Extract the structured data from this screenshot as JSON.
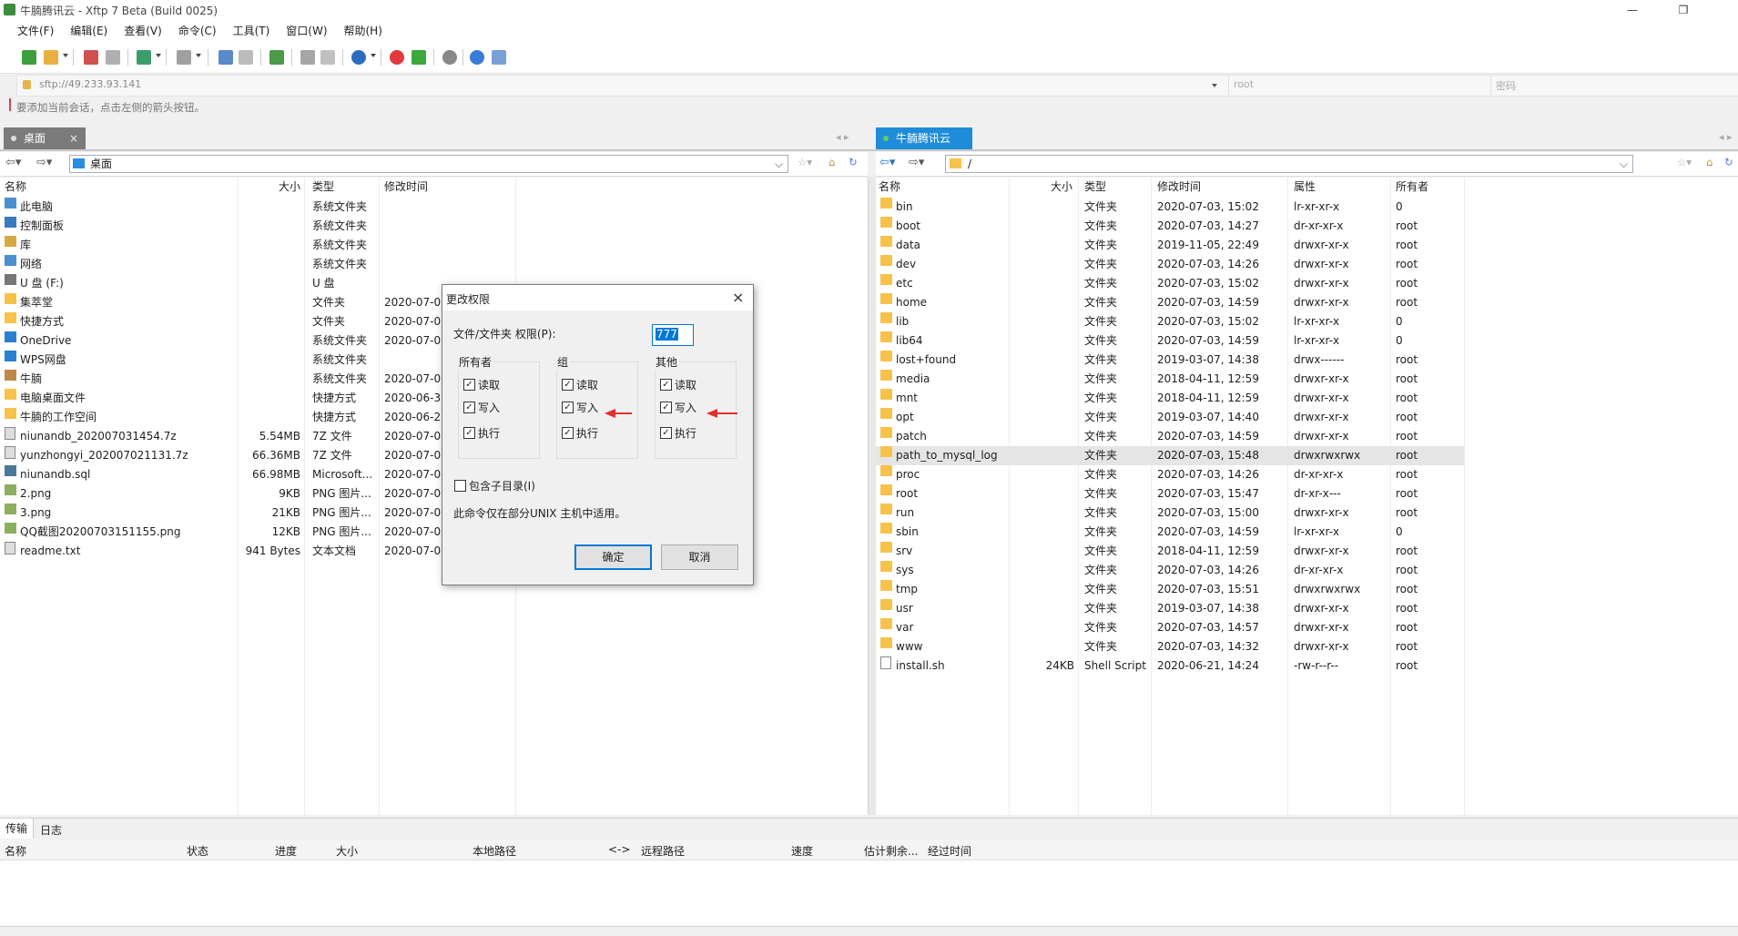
{
  "window": {
    "title": "牛腩腾讯云 - Xftp 7 Beta (Build 0025)"
  },
  "menu": [
    "文件(F)",
    "编辑(E)",
    "查看(V)",
    "命令(C)",
    "工具(T)",
    "窗口(W)",
    "帮助(H)"
  ],
  "address": {
    "url": "sftp://49.233.93.141",
    "user_placeholder": "root",
    "password_placeholder": "密码"
  },
  "hint": "要添加当前会话，点击左侧的箭头按钮。",
  "left": {
    "tab": "桌面",
    "path": "桌面",
    "columns": [
      "名称",
      "大小",
      "类型",
      "修改时间"
    ],
    "rows": [
      {
        "name": "此电脑",
        "size": "",
        "type": "系统文件夹",
        "date": "",
        "icon": "computer-icon"
      },
      {
        "name": "控制面板",
        "size": "",
        "type": "系统文件夹",
        "date": "",
        "icon": "control-panel-icon"
      },
      {
        "name": "库",
        "size": "",
        "type": "系统文件夹",
        "date": "",
        "icon": "library-icon"
      },
      {
        "name": "网络",
        "size": "",
        "type": "系统文件夹",
        "date": "",
        "icon": "network-icon"
      },
      {
        "name": "U 盘 (F:)",
        "size": "",
        "type": "U 盘",
        "date": "",
        "icon": "usb-drive-icon"
      },
      {
        "name": "集萃堂",
        "size": "",
        "type": "文件夹",
        "date": "2020-07-0",
        "icon": "folder-icon"
      },
      {
        "name": "快捷方式",
        "size": "",
        "type": "文件夹",
        "date": "2020-07-0",
        "icon": "folder-icon"
      },
      {
        "name": "OneDrive",
        "size": "",
        "type": "系统文件夹",
        "date": "2020-07-0",
        "icon": "cloud-icon"
      },
      {
        "name": "WPS网盘",
        "size": "",
        "type": "系统文件夹",
        "date": "",
        "icon": "cloud-icon"
      },
      {
        "name": "牛腩",
        "size": "",
        "type": "系统文件夹",
        "date": "2020-07-0",
        "icon": "user-icon"
      },
      {
        "name": "电脑桌面文件",
        "size": "",
        "type": "快捷方式",
        "date": "2020-06-3",
        "icon": "shortcut-icon"
      },
      {
        "name": "牛腩的工作空间",
        "size": "",
        "type": "快捷方式",
        "date": "2020-06-2",
        "icon": "shortcut-icon"
      },
      {
        "name": "niunandb_202007031454.7z",
        "size": "5.54MB",
        "type": "7Z 文件",
        "date": "2020-07-0",
        "icon": "file-icon"
      },
      {
        "name": "yunzhongyi_202007021131.7z",
        "size": "66.36MB",
        "type": "7Z 文件",
        "date": "2020-07-0",
        "icon": "file-icon"
      },
      {
        "name": "niunandb.sql",
        "size": "66.98MB",
        "type": "Microsoft...",
        "date": "2020-07-0",
        "icon": "sql-file-icon"
      },
      {
        "name": "2.png",
        "size": "9KB",
        "type": "PNG 图片...",
        "date": "2020-07-0",
        "icon": "image-icon"
      },
      {
        "name": "3.png",
        "size": "21KB",
        "type": "PNG 图片...",
        "date": "2020-07-0",
        "icon": "image-icon"
      },
      {
        "name": "QQ截图20200703151155.png",
        "size": "12KB",
        "type": "PNG 图片...",
        "date": "2020-07-0",
        "icon": "image-icon"
      },
      {
        "name": "readme.txt",
        "size": "941 Bytes",
        "type": "文本文档",
        "date": "2020-07-0",
        "icon": "text-file-icon"
      }
    ]
  },
  "right": {
    "tab": "牛腩腾讯云",
    "path": "/",
    "columns": [
      "名称",
      "大小",
      "类型",
      "修改时间",
      "属性",
      "所有者"
    ],
    "rows": [
      {
        "name": "bin",
        "size": "",
        "type": "文件夹",
        "date": "2020-07-03, 15:02",
        "attr": "lr-xr-xr-x",
        "owner": "0",
        "link": true
      },
      {
        "name": "boot",
        "size": "",
        "type": "文件夹",
        "date": "2020-07-03, 14:27",
        "attr": "dr-xr-xr-x",
        "owner": "root"
      },
      {
        "name": "data",
        "size": "",
        "type": "文件夹",
        "date": "2019-11-05, 22:49",
        "attr": "drwxr-xr-x",
        "owner": "root"
      },
      {
        "name": "dev",
        "size": "",
        "type": "文件夹",
        "date": "2020-07-03, 14:26",
        "attr": "drwxr-xr-x",
        "owner": "root"
      },
      {
        "name": "etc",
        "size": "",
        "type": "文件夹",
        "date": "2020-07-03, 15:02",
        "attr": "drwxr-xr-x",
        "owner": "root"
      },
      {
        "name": "home",
        "size": "",
        "type": "文件夹",
        "date": "2020-07-03, 14:59",
        "attr": "drwxr-xr-x",
        "owner": "root"
      },
      {
        "name": "lib",
        "size": "",
        "type": "文件夹",
        "date": "2020-07-03, 15:02",
        "attr": "lr-xr-xr-x",
        "owner": "0",
        "link": true
      },
      {
        "name": "lib64",
        "size": "",
        "type": "文件夹",
        "date": "2020-07-03, 14:59",
        "attr": "lr-xr-xr-x",
        "owner": "0",
        "link": true
      },
      {
        "name": "lost+found",
        "size": "",
        "type": "文件夹",
        "date": "2019-03-07, 14:38",
        "attr": "drwx------",
        "owner": "root"
      },
      {
        "name": "media",
        "size": "",
        "type": "文件夹",
        "date": "2018-04-11, 12:59",
        "attr": "drwxr-xr-x",
        "owner": "root"
      },
      {
        "name": "mnt",
        "size": "",
        "type": "文件夹",
        "date": "2018-04-11, 12:59",
        "attr": "drwxr-xr-x",
        "owner": "root"
      },
      {
        "name": "opt",
        "size": "",
        "type": "文件夹",
        "date": "2019-03-07, 14:40",
        "attr": "drwxr-xr-x",
        "owner": "root"
      },
      {
        "name": "patch",
        "size": "",
        "type": "文件夹",
        "date": "2020-07-03, 14:59",
        "attr": "drwxr-xr-x",
        "owner": "root"
      },
      {
        "name": "path_to_mysql_log",
        "size": "",
        "type": "文件夹",
        "date": "2020-07-03, 15:48",
        "attr": "drwxrwxrwx",
        "owner": "root",
        "selected": true
      },
      {
        "name": "proc",
        "size": "",
        "type": "文件夹",
        "date": "2020-07-03, 14:26",
        "attr": "dr-xr-xr-x",
        "owner": "root"
      },
      {
        "name": "root",
        "size": "",
        "type": "文件夹",
        "date": "2020-07-03, 15:47",
        "attr": "dr-xr-x---",
        "owner": "root"
      },
      {
        "name": "run",
        "size": "",
        "type": "文件夹",
        "date": "2020-07-03, 15:00",
        "attr": "drwxr-xr-x",
        "owner": "root"
      },
      {
        "name": "sbin",
        "size": "",
        "type": "文件夹",
        "date": "2020-07-03, 14:59",
        "attr": "lr-xr-xr-x",
        "owner": "0",
        "link": true
      },
      {
        "name": "srv",
        "size": "",
        "type": "文件夹",
        "date": "2018-04-11, 12:59",
        "attr": "drwxr-xr-x",
        "owner": "root"
      },
      {
        "name": "sys",
        "size": "",
        "type": "文件夹",
        "date": "2020-07-03, 14:26",
        "attr": "dr-xr-xr-x",
        "owner": "root"
      },
      {
        "name": "tmp",
        "size": "",
        "type": "文件夹",
        "date": "2020-07-03, 15:51",
        "attr": "drwxrwxrwx",
        "owner": "root"
      },
      {
        "name": "usr",
        "size": "",
        "type": "文件夹",
        "date": "2019-03-07, 14:38",
        "attr": "drwxr-xr-x",
        "owner": "root"
      },
      {
        "name": "var",
        "size": "",
        "type": "文件夹",
        "date": "2020-07-03, 14:57",
        "attr": "drwxr-xr-x",
        "owner": "root"
      },
      {
        "name": "www",
        "size": "",
        "type": "文件夹",
        "date": "2020-07-03, 14:32",
        "attr": "drwxr-xr-x",
        "owner": "root"
      },
      {
        "name": "install.sh",
        "size": "24KB",
        "type": "Shell Script",
        "date": "2020-06-21, 14:24",
        "attr": "-rw-r--r--",
        "owner": "root",
        "file": true
      }
    ]
  },
  "dialog": {
    "title": "更改权限",
    "perm_label": "文件/文件夹 权限(P):",
    "perm_value": "777",
    "groups": [
      {
        "label": "所有者",
        "read": "读取",
        "write": "写入",
        "exec": "执行"
      },
      {
        "label": "组",
        "read": "读取",
        "write": "写入",
        "exec": "执行"
      },
      {
        "label": "其他",
        "read": "读取",
        "write": "写入",
        "exec": "执行"
      }
    ],
    "recursive_label": "包含子目录(I)",
    "note": "此命令仅在部分UNIX 主机中适用。",
    "ok": "确定",
    "cancel": "取消"
  },
  "bottom": {
    "tabs": [
      "传输",
      "日志"
    ],
    "columns": [
      "名称",
      "状态",
      "进度",
      "大小",
      "本地路径",
      "<->",
      "远程路径",
      "速度",
      "估计剩余...",
      "经过时间"
    ]
  },
  "colors": {
    "accent": "#1e8cd8",
    "tab_inactive": "#7b7b7b",
    "arrow": "#e03030"
  }
}
